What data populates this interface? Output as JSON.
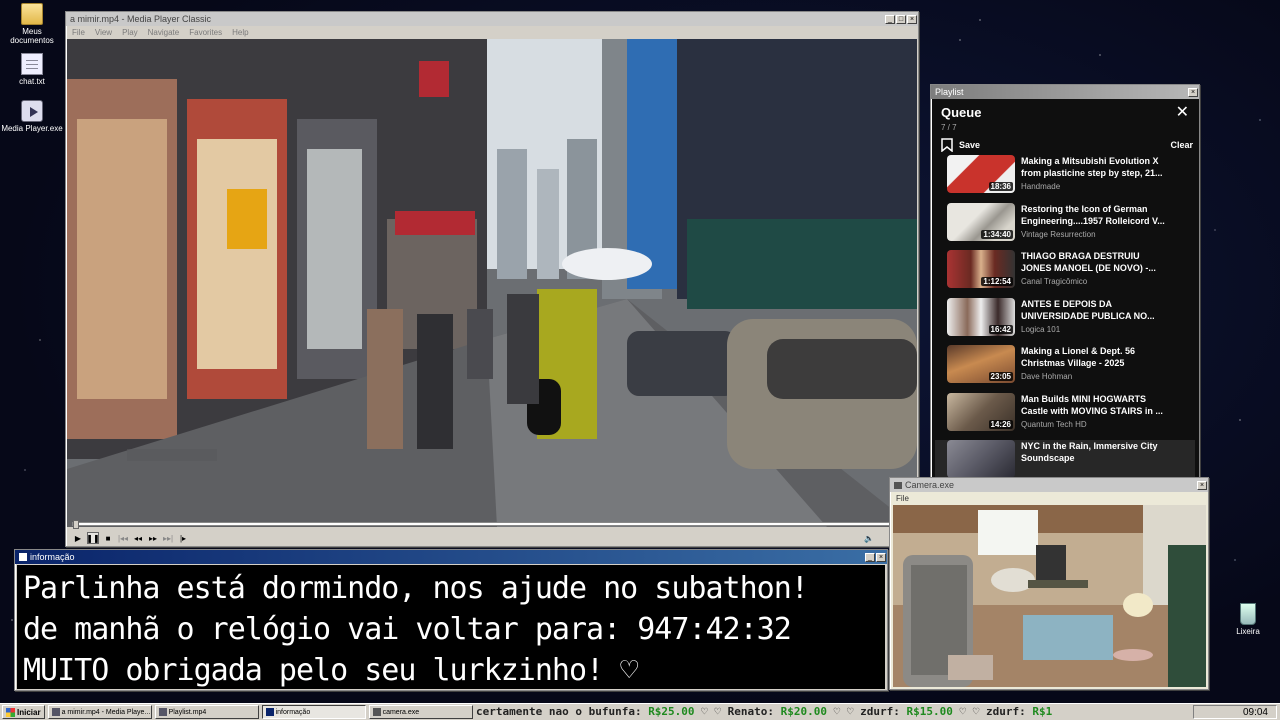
{
  "desktop": {
    "icons": [
      {
        "label": "Meus documentos",
        "icon": "folder-icon"
      },
      {
        "label": "chat.txt",
        "icon": "notepad-icon"
      },
      {
        "label": "Media Player.exe",
        "icon": "media-player-icon"
      },
      {
        "label": "Lixeira",
        "icon": "recycle-bin-icon"
      }
    ]
  },
  "media_player": {
    "title": "a mimir.mp4 - Media Player Classic",
    "menu": [
      "File",
      "View",
      "Play",
      "Navigate",
      "Favorites",
      "Help"
    ],
    "progress": 0.0
  },
  "playlist": {
    "window_title": "Playlist",
    "heading": "Queue",
    "count": "7 / 7",
    "save_label": "Save",
    "clear_label": "Clear",
    "items": [
      {
        "title": "Making a Mitsubishi Evolution X from plasticine step by step, 21...",
        "channel": "Handmade",
        "duration": "18:36",
        "thumb_color": "#c9332c"
      },
      {
        "title": "Restoring the Icon of German Engineering....1957 Rolleicord V...",
        "channel": "Vintage Resurrection",
        "duration": "1:34:40",
        "thumb_color": "#d8d5cc"
      },
      {
        "title": "THIAGO BRAGA DESTRUIU JONES MANOEL (DE NOVO) -...",
        "channel": "Canal Tragicômico",
        "duration": "1:12:54",
        "thumb_color": "#6a2a22"
      },
      {
        "title": "ANTES E DEPOIS DA UNIVERSIDADE PUBLICA NO...",
        "channel": "Logica 101",
        "duration": "16:42",
        "thumb_color": "#8a6a5a"
      },
      {
        "title": "Making a Lionel & Dept. 56 Christmas Village - 2025",
        "channel": "Dave Hohman",
        "duration": "23:05",
        "thumb_color": "#7a4a30"
      },
      {
        "title": "Man Builds MINI HOGWARTS Castle with MOVING STAIRS in ...",
        "channel": "Quantum Tech HD",
        "duration": "14:26",
        "thumb_color": "#6b5a4a"
      },
      {
        "title": "NYC in the Rain, Immersive City Soundscape",
        "channel": "",
        "duration": "",
        "thumb_color": "#5a5a66"
      }
    ]
  },
  "info_window": {
    "title": "informação",
    "lines": [
      "Parlinha está dormindo, nos ajude no subathon!",
      "de manhã o relógio vai voltar para:  947:42:32",
      "MUITO obrigada pelo seu lurkzinho! ♡"
    ]
  },
  "camera": {
    "title": "Camera.exe",
    "menu": [
      "File"
    ]
  },
  "taskbar": {
    "start_label": "Iniciar",
    "tasks": [
      {
        "label": "a mimir.mp4 - Media Playe...",
        "pressed": false
      },
      {
        "label": "Playlist.mp4",
        "pressed": false
      },
      {
        "label": "informação",
        "pressed": true
      },
      {
        "label": "camera.exe",
        "pressed": false
      }
    ],
    "ticker": [
      {
        "text": "certamente nao o bufunfa: ",
        "money": "R$25.00",
        "heart": " ♡ "
      },
      {
        "text": "  ♡ Renato: ",
        "money": "R$20.00",
        "heart": " ♡ "
      },
      {
        "text": "  ♡ zdurf: ",
        "money": "R$15.00",
        "heart": " ♡ "
      },
      {
        "text": "  ♡ zdurf: ",
        "money": "R$1",
        "heart": ""
      }
    ],
    "clock": "09:04"
  }
}
